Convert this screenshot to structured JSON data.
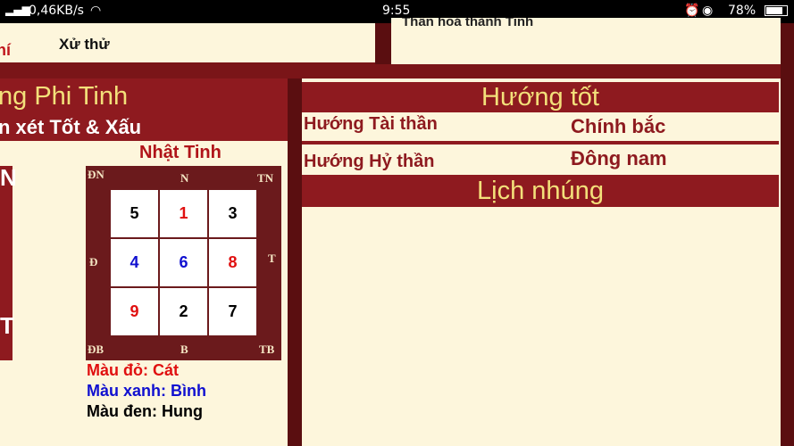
{
  "status_bar": {
    "speed": "0,46KB/s",
    "time": "9:55",
    "battery": "78%"
  },
  "top": {
    "left_label": "hí",
    "xu_thu": "Xử thử",
    "right_cut_text": "Thần hoá thành Tinh"
  },
  "left_panel": {
    "title": "ng Phi Tinh",
    "subtitle": "n xét Tốt & Xấu",
    "left_letters": [
      "N",
      "T"
    ],
    "grid_title": "Nhật Tinh",
    "directions": {
      "top_left": "ĐN",
      "top": "N",
      "top_right": "TN",
      "left": "Đ",
      "right": "T",
      "bottom_left": "ĐB",
      "bottom": "B",
      "bottom_right": "TB"
    },
    "grid": [
      {
        "value": "5",
        "color": "#000000"
      },
      {
        "value": "1",
        "color": "#e01010"
      },
      {
        "value": "3",
        "color": "#000000"
      },
      {
        "value": "4",
        "color": "#1010d0"
      },
      {
        "value": "6",
        "color": "#1010d0"
      },
      {
        "value": "8",
        "color": "#e01010"
      },
      {
        "value": "9",
        "color": "#e01010"
      },
      {
        "value": "2",
        "color": "#000000"
      },
      {
        "value": "7",
        "color": "#000000"
      }
    ],
    "legend": [
      {
        "text": "Màu đỏ: Cát",
        "color": "#e01010"
      },
      {
        "text": "Màu xanh: Bình",
        "color": "#1010d0"
      },
      {
        "text": "Màu đen: Hung",
        "color": "#000000"
      }
    ]
  },
  "right_panel": {
    "good_direction_title": "Hướng tốt",
    "rows": [
      {
        "label": "Hướng Tài thần",
        "value": "Chính bắc"
      },
      {
        "label": "Hướng Hỷ thần",
        "value": "Đông nam"
      }
    ],
    "embed_title": "Lịch nhúng"
  },
  "colors": {
    "dark_red": "#8e1a1f",
    "cream": "#fdf6dc",
    "gold": "#f3e07a"
  }
}
